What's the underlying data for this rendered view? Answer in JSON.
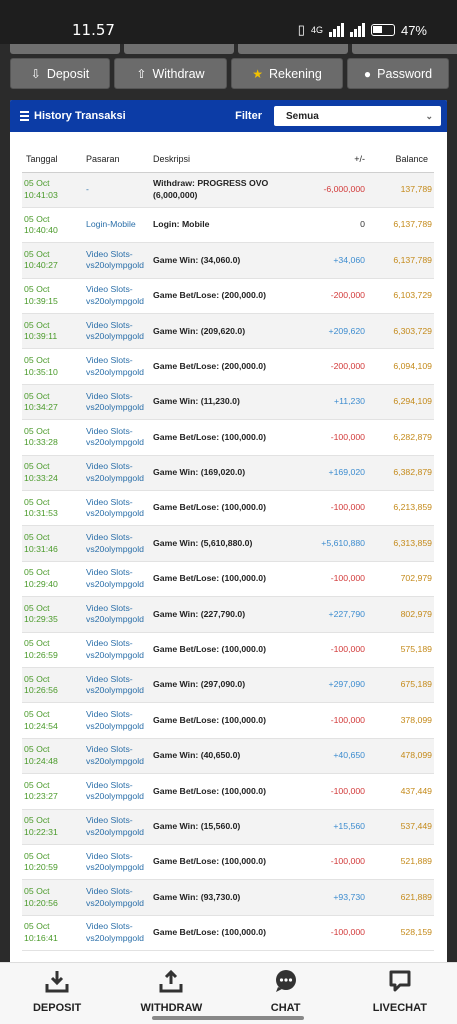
{
  "status": {
    "time": "11.57",
    "network": "4G",
    "battery": "47%"
  },
  "nav_buttons": [
    {
      "label": "Deposit",
      "icon": "deposit-icon"
    },
    {
      "label": "Withdraw",
      "icon": "withdraw-icon"
    },
    {
      "label": "Rekening",
      "icon": "bank-icon"
    },
    {
      "label": "Password",
      "icon": "user-icon"
    }
  ],
  "panel": {
    "title": "History Transaksi",
    "filter_label": "Filter",
    "filter_value": "Semua"
  },
  "table": {
    "headers": [
      "Tanggal",
      "Pasaran",
      "Deskripsi",
      "+/-",
      "Balance"
    ],
    "rows": [
      {
        "date": "05 Oct",
        "time": "10:41:03",
        "pasaran": "-",
        "pasaran2": "",
        "desc": "Withdraw: PROGRESS OVO",
        "desc2": "(6,000,000)",
        "amount": "-6,000,000",
        "balance": "137,789",
        "type": "neg"
      },
      {
        "date": "05 Oct",
        "time": "10:40:40",
        "pasaran": "Login-Mobile",
        "pasaran2": "",
        "desc": "Login: Mobile",
        "desc2": "",
        "amount": "0",
        "balance": "6,137,789",
        "type": "zero"
      },
      {
        "date": "05 Oct",
        "time": "10:40:27",
        "pasaran": "Video Slots-",
        "pasaran2": "vs20olympgold",
        "desc": "Game Win: (34,060.0)",
        "desc2": "",
        "amount": "+34,060",
        "balance": "6,137,789",
        "type": "pos"
      },
      {
        "date": "05 Oct",
        "time": "10:39:15",
        "pasaran": "Video Slots-",
        "pasaran2": "vs20olympgold",
        "desc": "Game Bet/Lose: (200,000.0)",
        "desc2": "",
        "amount": "-200,000",
        "balance": "6,103,729",
        "type": "neg"
      },
      {
        "date": "05 Oct",
        "time": "10:39:11",
        "pasaran": "Video Slots-",
        "pasaran2": "vs20olympgold",
        "desc": "Game Win: (209,620.0)",
        "desc2": "",
        "amount": "+209,620",
        "balance": "6,303,729",
        "type": "pos"
      },
      {
        "date": "05 Oct",
        "time": "10:35:10",
        "pasaran": "Video Slots-",
        "pasaran2": "vs20olympgold",
        "desc": "Game Bet/Lose: (200,000.0)",
        "desc2": "",
        "amount": "-200,000",
        "balance": "6,094,109",
        "type": "neg"
      },
      {
        "date": "05 Oct",
        "time": "10:34:27",
        "pasaran": "Video Slots-",
        "pasaran2": "vs20olympgold",
        "desc": "Game Win: (11,230.0)",
        "desc2": "",
        "amount": "+11,230",
        "balance": "6,294,109",
        "type": "pos"
      },
      {
        "date": "05 Oct",
        "time": "10:33:28",
        "pasaran": "Video Slots-",
        "pasaran2": "vs20olympgold",
        "desc": "Game Bet/Lose: (100,000.0)",
        "desc2": "",
        "amount": "-100,000",
        "balance": "6,282,879",
        "type": "neg"
      },
      {
        "date": "05 Oct",
        "time": "10:33:24",
        "pasaran": "Video Slots-",
        "pasaran2": "vs20olympgold",
        "desc": "Game Win: (169,020.0)",
        "desc2": "",
        "amount": "+169,020",
        "balance": "6,382,879",
        "type": "pos"
      },
      {
        "date": "05 Oct",
        "time": "10:31:53",
        "pasaran": "Video Slots-",
        "pasaran2": "vs20olympgold",
        "desc": "Game Bet/Lose: (100,000.0)",
        "desc2": "",
        "amount": "-100,000",
        "balance": "6,213,859",
        "type": "neg"
      },
      {
        "date": "05 Oct",
        "time": "10:31:46",
        "pasaran": "Video Slots-",
        "pasaran2": "vs20olympgold",
        "desc": "Game Win: (5,610,880.0)",
        "desc2": "",
        "amount": "+5,610,880",
        "balance": "6,313,859",
        "type": "pos"
      },
      {
        "date": "05 Oct",
        "time": "10:29:40",
        "pasaran": "Video Slots-",
        "pasaran2": "vs20olympgold",
        "desc": "Game Bet/Lose: (100,000.0)",
        "desc2": "",
        "amount": "-100,000",
        "balance": "702,979",
        "type": "neg"
      },
      {
        "date": "05 Oct",
        "time": "10:29:35",
        "pasaran": "Video Slots-",
        "pasaran2": "vs20olympgold",
        "desc": "Game Win: (227,790.0)",
        "desc2": "",
        "amount": "+227,790",
        "balance": "802,979",
        "type": "pos"
      },
      {
        "date": "05 Oct",
        "time": "10:26:59",
        "pasaran": "Video Slots-",
        "pasaran2": "vs20olympgold",
        "desc": "Game Bet/Lose: (100,000.0)",
        "desc2": "",
        "amount": "-100,000",
        "balance": "575,189",
        "type": "neg"
      },
      {
        "date": "05 Oct",
        "time": "10:26:56",
        "pasaran": "Video Slots-",
        "pasaran2": "vs20olympgold",
        "desc": "Game Win: (297,090.0)",
        "desc2": "",
        "amount": "+297,090",
        "balance": "675,189",
        "type": "pos"
      },
      {
        "date": "05 Oct",
        "time": "10:24:54",
        "pasaran": "Video Slots-",
        "pasaran2": "vs20olympgold",
        "desc": "Game Bet/Lose: (100,000.0)",
        "desc2": "",
        "amount": "-100,000",
        "balance": "378,099",
        "type": "neg"
      },
      {
        "date": "05 Oct",
        "time": "10:24:48",
        "pasaran": "Video Slots-",
        "pasaran2": "vs20olympgold",
        "desc": "Game Win: (40,650.0)",
        "desc2": "",
        "amount": "+40,650",
        "balance": "478,099",
        "type": "pos"
      },
      {
        "date": "05 Oct",
        "time": "10:23:27",
        "pasaran": "Video Slots-",
        "pasaran2": "vs20olympgold",
        "desc": "Game Bet/Lose: (100,000.0)",
        "desc2": "",
        "amount": "-100,000",
        "balance": "437,449",
        "type": "neg"
      },
      {
        "date": "05 Oct",
        "time": "10:22:31",
        "pasaran": "Video Slots-",
        "pasaran2": "vs20olympgold",
        "desc": "Game Win: (15,560.0)",
        "desc2": "",
        "amount": "+15,560",
        "balance": "537,449",
        "type": "pos"
      },
      {
        "date": "05 Oct",
        "time": "10:20:59",
        "pasaran": "Video Slots-",
        "pasaran2": "vs20olympgold",
        "desc": "Game Bet/Lose: (100,000.0)",
        "desc2": "",
        "amount": "-100,000",
        "balance": "521,889",
        "type": "neg"
      },
      {
        "date": "05 Oct",
        "time": "10:20:56",
        "pasaran": "Video Slots-",
        "pasaran2": "vs20olympgold",
        "desc": "Game Win: (93,730.0)",
        "desc2": "",
        "amount": "+93,730",
        "balance": "621,889",
        "type": "pos"
      },
      {
        "date": "05 Oct",
        "time": "10:16:41",
        "pasaran": "Video Slots-",
        "pasaran2": "vs20olympgold",
        "desc": "Game Bet/Lose: (100,000.0)",
        "desc2": "",
        "amount": "-100,000",
        "balance": "528,159",
        "type": "neg"
      }
    ]
  },
  "bottom_nav": [
    {
      "label": "DEPOSIT",
      "icon": "download-icon"
    },
    {
      "label": "WITHDRAW",
      "icon": "upload-icon"
    },
    {
      "label": "CHAT",
      "icon": "chat-icon"
    },
    {
      "label": "LIVECHAT",
      "icon": "livechat-icon"
    }
  ],
  "colors": {
    "header_blue": "#0c3ca6",
    "date_green": "#4a9a2a",
    "pasaran_blue": "#2b6fa9",
    "negative_red": "#d23a3a",
    "positive_blue": "#3d8ccf",
    "balance_gold": "#c48a1a"
  }
}
